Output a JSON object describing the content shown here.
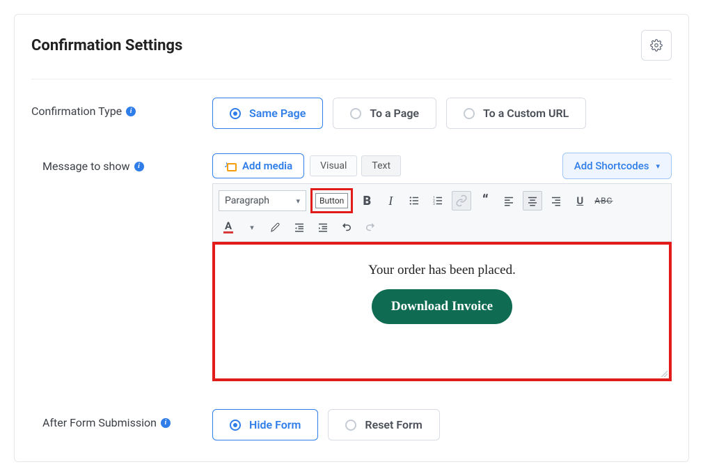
{
  "header": {
    "title": "Confirmation Settings"
  },
  "confirmation_type": {
    "label": "Confirmation Type",
    "options": {
      "same_page": "Same Page",
      "to_page": "To a Page",
      "to_custom_url": "To a Custom URL"
    },
    "selected": "same_page"
  },
  "message_section": {
    "label": "Message to show",
    "add_media_label": "Add media",
    "tabs": {
      "visual": "Visual",
      "text": "Text"
    },
    "add_shortcodes_label": "Add Shortcodes",
    "format_selector": "Paragraph",
    "button_chip": "Button",
    "canvas": {
      "message_text": "Your order has been placed.",
      "download_button_text": "Download Invoice"
    },
    "abc_strike": "ABC"
  },
  "after_submission": {
    "label": "After Form Submission",
    "options": {
      "hide_form": "Hide Form",
      "reset_form": "Reset Form"
    },
    "selected": "hide_form"
  }
}
